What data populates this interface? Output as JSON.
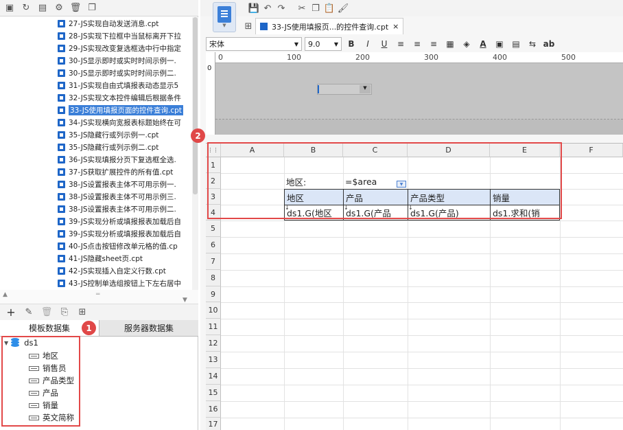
{
  "left_panel": {
    "template_files": [
      "27-JS实现自动发送消息.cpt",
      "28-JS实现下拉框中当鼠标离开下拉",
      "29-JS实现改变复选框选中行中指定",
      "30-JS显示即时或实时时间示例一.",
      "30-JS显示即时或实时时间示例二.",
      "31-JS实现自由式填报表动态显示5",
      "32-JS实现文本控件编辑后根据条件",
      "33-JS使用填报页面的控件查询.cpt",
      "34-JS实现横向宽报表标题始终在可",
      "35-JS隐藏行或列示例一.cpt",
      "35-JS隐藏行或列示例二.cpt",
      "36-JS实现填报分页下复选框全选.",
      "37-JS获取扩展控件的所有值.cpt",
      "38-JS设置报表主体不可用示例一.",
      "38-JS设置报表主体不可用示例三.",
      "38-JS设置报表主体不可用示例二.",
      "39-JS实现分析或填报报表加载后自",
      "39-JS实现分析或填报报表加载后自",
      "40-JS点击按钮修改单元格的值.cp",
      "41-JS隐藏sheet页.cpt",
      "42-JS实现插入自定义行数.cpt",
      "43-JS控制单选组按钮上下左右居中"
    ],
    "selected_index": 7,
    "dataset_tabs": [
      "模板数据集",
      "服务器数据集"
    ],
    "dataset_name": "ds1",
    "dataset_fields": [
      "地区",
      "销售员",
      "产品类型",
      "产品",
      "销量",
      "英文简称"
    ],
    "markers": [
      "1",
      "2"
    ]
  },
  "editor": {
    "doc_tab": "33-JS使用填报页...的控件查询.cpt",
    "doc_tab_close": "×",
    "font_name": "宋体",
    "font_size": "9.0",
    "bold": "B",
    "italic": "I",
    "underline": "U",
    "ab_label": "ab",
    "ruler_marks": [
      "0",
      "100",
      "200",
      "300",
      "400",
      "500"
    ],
    "vruler_mark": "0"
  },
  "sheet": {
    "columns": [
      "A",
      "B",
      "C",
      "D",
      "E",
      "F"
    ],
    "rows": [
      "1",
      "2",
      "3",
      "4",
      "5",
      "6",
      "7",
      "8",
      "9",
      "10",
      "11",
      "12",
      "13",
      "14",
      "15",
      "16",
      "17"
    ],
    "b2": "地区:",
    "c2": "=$area",
    "header_row": [
      "地区",
      "产品",
      "产品类型",
      "销量"
    ],
    "data_row": [
      "ds1.G(地区",
      "ds1.G(产品",
      "ds1.G(产品)",
      "ds1.求和(销"
    ]
  },
  "colors": {
    "highlight": "#e24848",
    "header_fill": "#dbe6f7",
    "selection": "#3b7fd8"
  }
}
